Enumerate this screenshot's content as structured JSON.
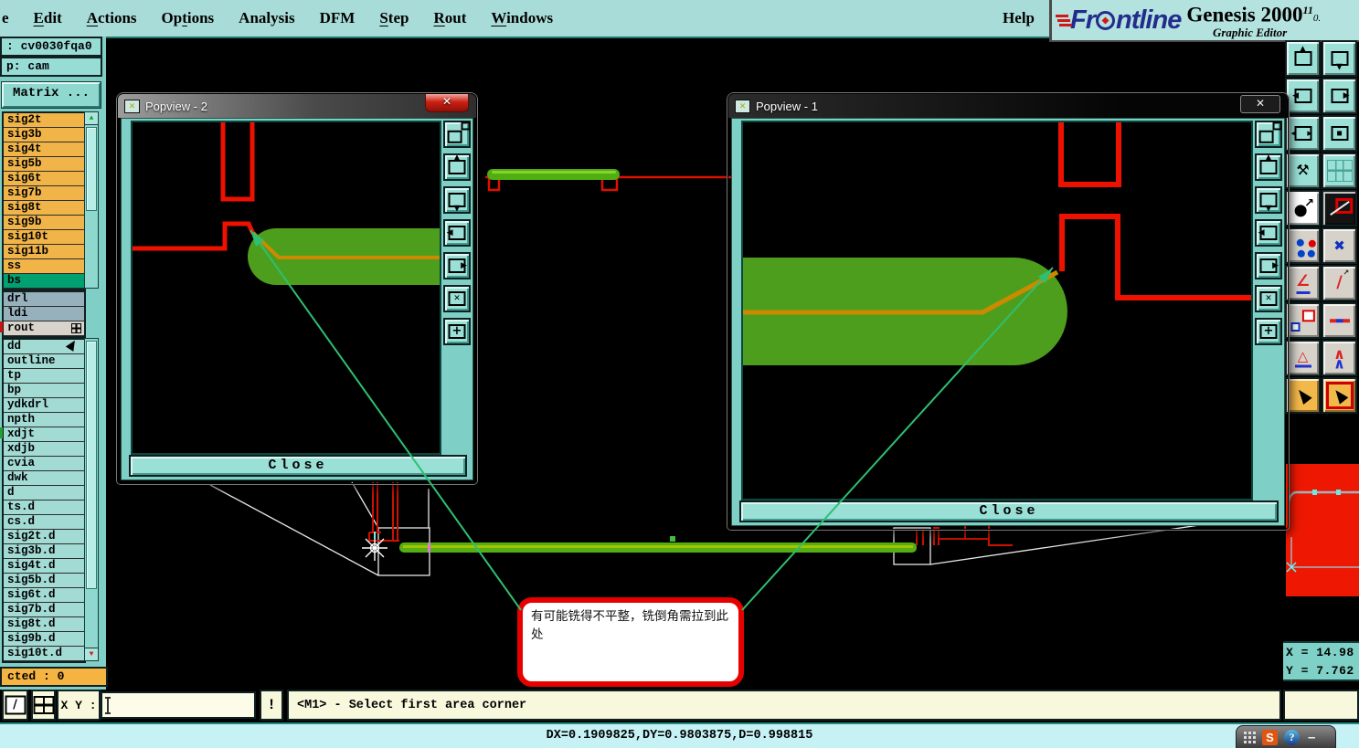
{
  "menubar": {
    "items": [
      {
        "name": "file",
        "pre": "",
        "u": "",
        "post": "e"
      },
      {
        "name": "edit",
        "pre": "",
        "u": "E",
        "post": "dit"
      },
      {
        "name": "actions",
        "pre": "",
        "u": "A",
        "post": "ctions"
      },
      {
        "name": "options",
        "pre": "Op",
        "u": "t",
        "post": "ions"
      },
      {
        "name": "analysis",
        "pre": "Analysis",
        "u": "",
        "post": ""
      },
      {
        "name": "dfm",
        "pre": "DFM",
        "u": "",
        "post": ""
      },
      {
        "name": "step",
        "pre": "",
        "u": "S",
        "post": "tep"
      },
      {
        "name": "rout",
        "pre": "",
        "u": "R",
        "post": "out"
      },
      {
        "name": "windows",
        "pre": "",
        "u": "W",
        "post": "indows"
      }
    ],
    "help": "Help"
  },
  "brand": {
    "logo_text_left": "Fr",
    "logo_text_right": "ntline",
    "product": "Genesis 2000",
    "version_sup": "11",
    "version_frag": "0.",
    "subtitle": "Graphic Editor"
  },
  "sidebar": {
    "job_label": ": cv0030fqa0",
    "step_label": "p: cam",
    "matrix_button": "Matrix ...",
    "signal_layers": [
      "sig2t",
      "sig3b",
      "sig4t",
      "sig5b",
      "sig6t",
      "sig7b",
      "sig8t",
      "sig9b",
      "sig10t",
      "sig11b",
      "ss"
    ],
    "selected_layer": "bs",
    "drill_layers": [
      "drl",
      "ldi"
    ],
    "rout_layer": "rout",
    "misc_layers": [
      "dd",
      "outline",
      "tp",
      "bp",
      "ydkdrl",
      "npth",
      "xdjt",
      "xdjb",
      "cvia",
      "dwk",
      "d",
      "ts.d",
      "cs.d",
      "sig2t.d",
      "sig3b.d",
      "sig4t.d",
      "sig5b.d",
      "sig6t.d",
      "sig7b.d",
      "sig8t.d",
      "sig9b.d",
      "sig10t.d"
    ],
    "selected_count": "cted : 0"
  },
  "popview2": {
    "title": "Popview - 2",
    "close_label": "Close",
    "close_glyph": "✕"
  },
  "popview1": {
    "title": "Popview - 1",
    "close_label": "Close",
    "close_glyph": "✕"
  },
  "annotation": {
    "text": "有可能铣得不平整，铣倒角需拉到此处"
  },
  "bottom_bar": {
    "xy_label": "X Y :",
    "xy_value": "",
    "alert_label": "!",
    "prompt": "<M1> - Select first area corner",
    "delta_readout": "DX=0.1909825,DY=0.9803875,D=0.998815"
  },
  "readout": {
    "x": "X = 14.98",
    "y": "Y = 7.762"
  },
  "taskbar": {
    "s_app": "S",
    "help_app": "?",
    "minimize": "–"
  },
  "right_toolbar": [
    {
      "name": "pan-up-button",
      "style": "teal",
      "icon": "box-up"
    },
    {
      "name": "pan-down-button",
      "style": "teal",
      "icon": "box-down"
    },
    {
      "name": "pan-left-button",
      "style": "teal",
      "icon": "box-left"
    },
    {
      "name": "pan-right-button",
      "style": "teal",
      "icon": "box-right"
    },
    {
      "name": "zoom-extents-button",
      "style": "teal",
      "icon": "box-expand"
    },
    {
      "name": "zoom-center-button",
      "style": "teal",
      "icon": "box-center"
    },
    {
      "name": "setup-tools-button",
      "style": "teal",
      "icon": "wrench"
    },
    {
      "name": "grid-toggle-button",
      "style": "teal",
      "icon": "grid"
    },
    {
      "name": "zoom-selected-button",
      "style": "white",
      "icon": "circle-arrow"
    },
    {
      "name": "shape-edit-button",
      "style": "dark",
      "icon": "square-pencil"
    },
    {
      "name": "net-points-button",
      "style": "light",
      "icon": "molecule"
    },
    {
      "name": "erase-button",
      "style": "light",
      "icon": "blue-x"
    },
    {
      "name": "measure-angle-button",
      "style": "light",
      "icon": "angle"
    },
    {
      "name": "measure-line-button",
      "style": "light",
      "icon": "slash"
    },
    {
      "name": "pad-snap-button",
      "style": "light",
      "icon": "square-dot"
    },
    {
      "name": "measure-width-button",
      "style": "light",
      "icon": "dash"
    },
    {
      "name": "triangle-up-button",
      "style": "light",
      "icon": "triangle"
    },
    {
      "name": "chevron-up-button",
      "style": "light",
      "icon": "chevron"
    },
    {
      "name": "select-mode-button",
      "style": "orange",
      "icon": "cursor"
    },
    {
      "name": "frame-select-button",
      "style": "orange",
      "icon": "cursor-box"
    }
  ],
  "popview_toolbar": [
    {
      "name": "popview-transfer-button",
      "icon": "transfer"
    },
    {
      "name": "pan-up-button",
      "icon": "box-up"
    },
    {
      "name": "pan-down-button",
      "icon": "box-down"
    },
    {
      "name": "pan-left-button",
      "icon": "box-left"
    },
    {
      "name": "pan-right-button",
      "icon": "box-right"
    },
    {
      "name": "zoom-in-button",
      "icon": "box-in"
    },
    {
      "name": "zoom-out-button",
      "icon": "box-out"
    }
  ],
  "colors": {
    "chrome_teal": "#a8dcd8",
    "button_teal": "#9ae0d6",
    "layer_orange": "#f0b449",
    "layer_selected_green": "#00a070",
    "trace_green": "#4e9e1e",
    "trace_center_orange": "#cc8a00",
    "outline_red": "#dd1100",
    "leader_green": "#2ebf70",
    "annotation_border_red": "#e60000",
    "status_cream": "#f8f8dc",
    "status_cyan": "#c6f2f6",
    "thumbnail_red": "#ee1802"
  }
}
